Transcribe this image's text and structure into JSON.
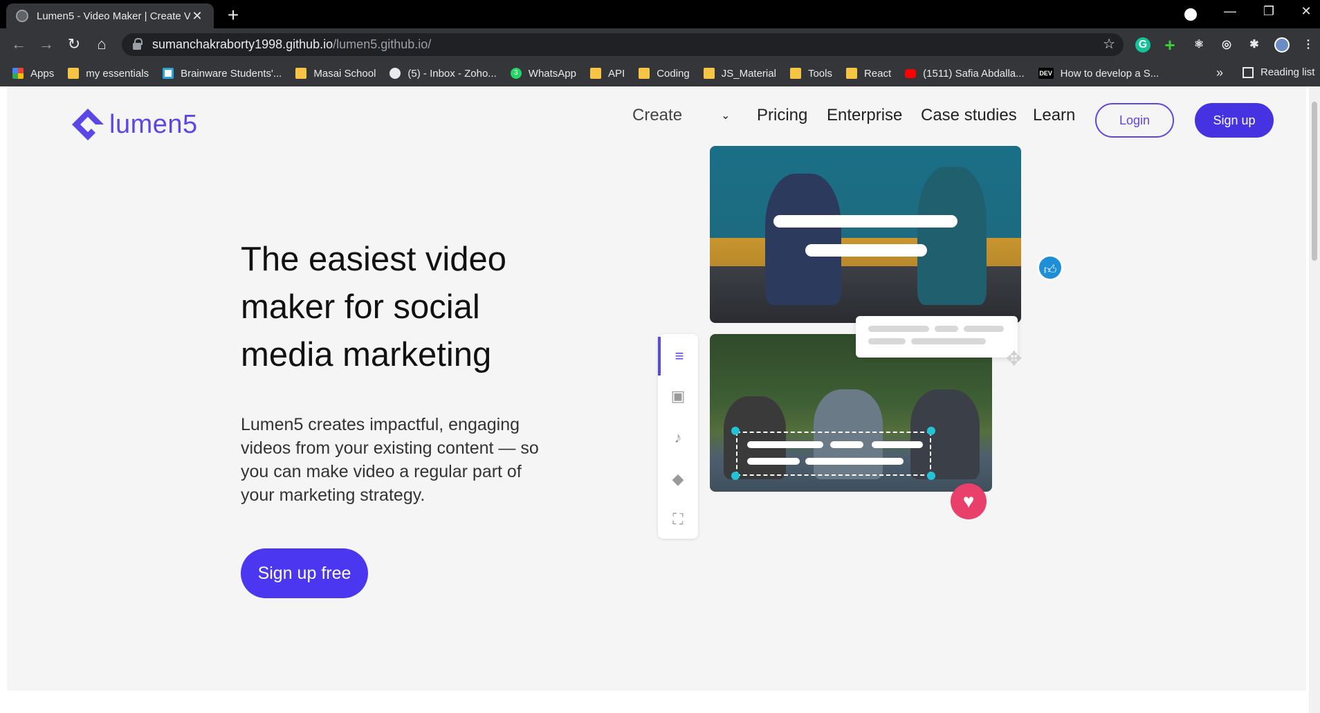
{
  "browser": {
    "tab_title": "Lumen5 - Video Maker | Create V",
    "url_host": "sumanchakraborty1998.github.io",
    "url_path": "/lumen5.github.io/",
    "bookmarks": [
      {
        "label": "Apps",
        "icon": "apps-grid-icon"
      },
      {
        "label": "my essentials",
        "icon": "folder-icon"
      },
      {
        "label": "Brainware Students'...",
        "icon": "brainware-icon"
      },
      {
        "label": "Masai School",
        "icon": "folder-icon"
      },
      {
        "label": "(5) - Inbox - Zoho...",
        "icon": "zoho-mail-icon"
      },
      {
        "label": "WhatsApp",
        "icon": "whatsapp-icon"
      },
      {
        "label": "API",
        "icon": "folder-icon"
      },
      {
        "label": "Coding",
        "icon": "folder-icon"
      },
      {
        "label": "JS_Material",
        "icon": "folder-icon"
      },
      {
        "label": "Tools",
        "icon": "folder-icon"
      },
      {
        "label": "React",
        "icon": "folder-icon"
      },
      {
        "label": "(1511) Safia Abdalla...",
        "icon": "youtube-icon"
      },
      {
        "label": "How to develop a S...",
        "icon": "dev-icon"
      }
    ],
    "bookmarks_more": "»",
    "reading_list": "Reading list",
    "whatsapp_badge": "3",
    "dev_badge": "DEV"
  },
  "site": {
    "logo_text": "lumen5",
    "nav": {
      "create": "Create",
      "pricing": "Pricing",
      "enterprise": "Enterprise",
      "case_studies": "Case studies",
      "learn": "Learn",
      "login": "Login",
      "signup": "Sign up"
    },
    "hero": {
      "title": "The easiest video maker for social media marketing",
      "description": "Lumen5 creates impactful, engaging videos from your existing content — so you can make video a regular part of your marketing strategy.",
      "cta": "Sign up free"
    }
  },
  "colors": {
    "brand": "#5b46e6",
    "cta": "#4b37f0",
    "like": "#1e8fd6",
    "heart": "#e8406b",
    "page_bg": "#f5f5f5"
  }
}
